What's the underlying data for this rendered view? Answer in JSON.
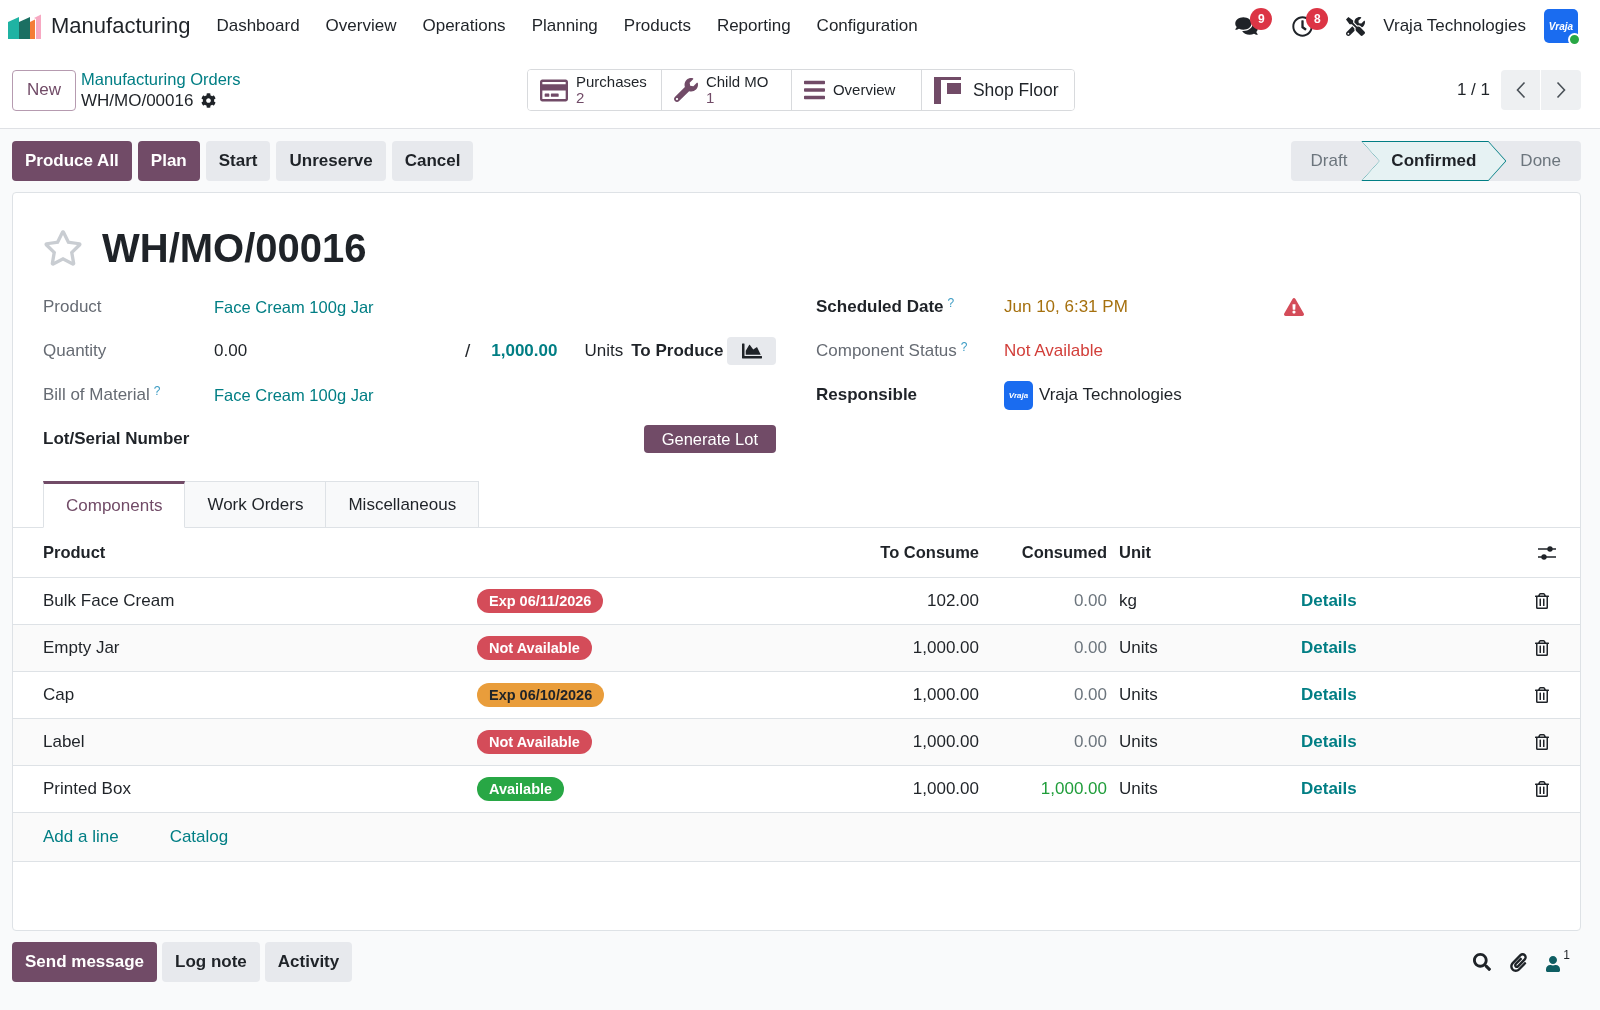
{
  "navbar": {
    "app_name": "Manufacturing",
    "menu": [
      "Dashboard",
      "Overview",
      "Operations",
      "Planning",
      "Products",
      "Reporting",
      "Configuration"
    ],
    "messages_count": "9",
    "activities_count": "8",
    "company": "Vraja Technologies",
    "avatar_label": "Vraja",
    "user_online": true
  },
  "control_panel": {
    "new_button": "New",
    "breadcrumb": {
      "parent": "Manufacturing Orders",
      "current": "WH/MO/00016"
    },
    "smart_buttons": [
      {
        "kind": "purchase",
        "label": "Purchases",
        "count": "2"
      },
      {
        "kind": "child",
        "label": "Child MO",
        "count": "1"
      },
      {
        "kind": "overview",
        "label": "Overview"
      },
      {
        "kind": "floor",
        "label": "Shop Floor"
      }
    ],
    "pager": "1 / 1"
  },
  "actions": [
    {
      "label": "Produce All",
      "primary": true
    },
    {
      "label": "Plan",
      "primary": true
    },
    {
      "label": "Start",
      "primary": false
    },
    {
      "label": "Unreserve",
      "primary": false
    },
    {
      "label": "Cancel",
      "primary": false
    }
  ],
  "status_steps": [
    {
      "label": "Draft",
      "selected": false
    },
    {
      "label": "Confirmed",
      "selected": true
    },
    {
      "label": "Done",
      "selected": false
    }
  ],
  "record": {
    "title": "WH/MO/00016",
    "starred": false,
    "fields_left": [
      {
        "kind": "link",
        "label": "Product",
        "readonly": true,
        "value": "Face Cream 100g Jar"
      },
      {
        "kind": "quantity",
        "label": "Quantity",
        "readonly": true,
        "value": "0.00",
        "separator": "/",
        "target": "1,000.00",
        "unit": "Units",
        "suffix": "To Produce"
      },
      {
        "kind": "link",
        "label": "Bill of Material",
        "readonly": true,
        "help": "?",
        "value": "Face Cream 100g Jar"
      },
      {
        "kind": "action",
        "label": "Lot/Serial Number",
        "readonly": false,
        "button": "Generate Lot"
      }
    ],
    "fields_right": [
      {
        "kind": "text",
        "label": "Scheduled Date",
        "readonly": false,
        "help": "?",
        "value": "Jun 10, 6:31 PM",
        "color": "#a5700e",
        "warning": true
      },
      {
        "kind": "text",
        "label": "Component Status",
        "readonly": true,
        "help": "?",
        "value": "Not Available",
        "color": "#d23f3a"
      },
      {
        "kind": "user",
        "label": "Responsible",
        "readonly": false,
        "value": "Vraja Technologies",
        "avatar_label": "Vraja"
      }
    ]
  },
  "tabs": [
    {
      "label": "Components",
      "selected": true
    },
    {
      "label": "Work Orders",
      "selected": false
    },
    {
      "label": "Miscellaneous",
      "selected": false
    }
  ],
  "components": {
    "columns": [
      "Product",
      "To Consume",
      "Consumed",
      "Unit"
    ],
    "rows": [
      {
        "product": "Bulk Face Cream",
        "availability": {
          "label": "Exp 06/11/2026",
          "color": "#d44c59"
        },
        "to_consume": "102.00",
        "consumed": "0.00",
        "consumed_complete": false,
        "unit": "kg",
        "action": "Details"
      },
      {
        "product": "Empty Jar",
        "availability": {
          "label": "Not Available",
          "color": "#d44c59"
        },
        "to_consume": "1,000.00",
        "consumed": "0.00",
        "consumed_complete": false,
        "unit": "Units",
        "action": "Details"
      },
      {
        "product": "Cap",
        "availability": {
          "label": "Exp 06/10/2026",
          "color": "#e99d3b"
        },
        "to_consume": "1,000.00",
        "consumed": "0.00",
        "consumed_complete": false,
        "unit": "Units",
        "action": "Details"
      },
      {
        "product": "Label",
        "availability": {
          "label": "Not Available",
          "color": "#d44c59"
        },
        "to_consume": "1,000.00",
        "consumed": "0.00",
        "consumed_complete": false,
        "unit": "Units",
        "action": "Details"
      },
      {
        "product": "Printed Box",
        "availability": {
          "label": "Available",
          "color": "#28a745"
        },
        "to_consume": "1,000.00",
        "consumed": "1,000.00",
        "consumed_complete": true,
        "unit": "Units",
        "action": "Details"
      }
    ],
    "add_links": [
      "Add a line",
      "Catalog"
    ]
  },
  "chatter": {
    "buttons": [
      {
        "label": "Send message",
        "primary": true
      },
      {
        "label": "Log note",
        "primary": false
      },
      {
        "label": "Activity",
        "primary": false
      }
    ],
    "followers_count": "1"
  }
}
